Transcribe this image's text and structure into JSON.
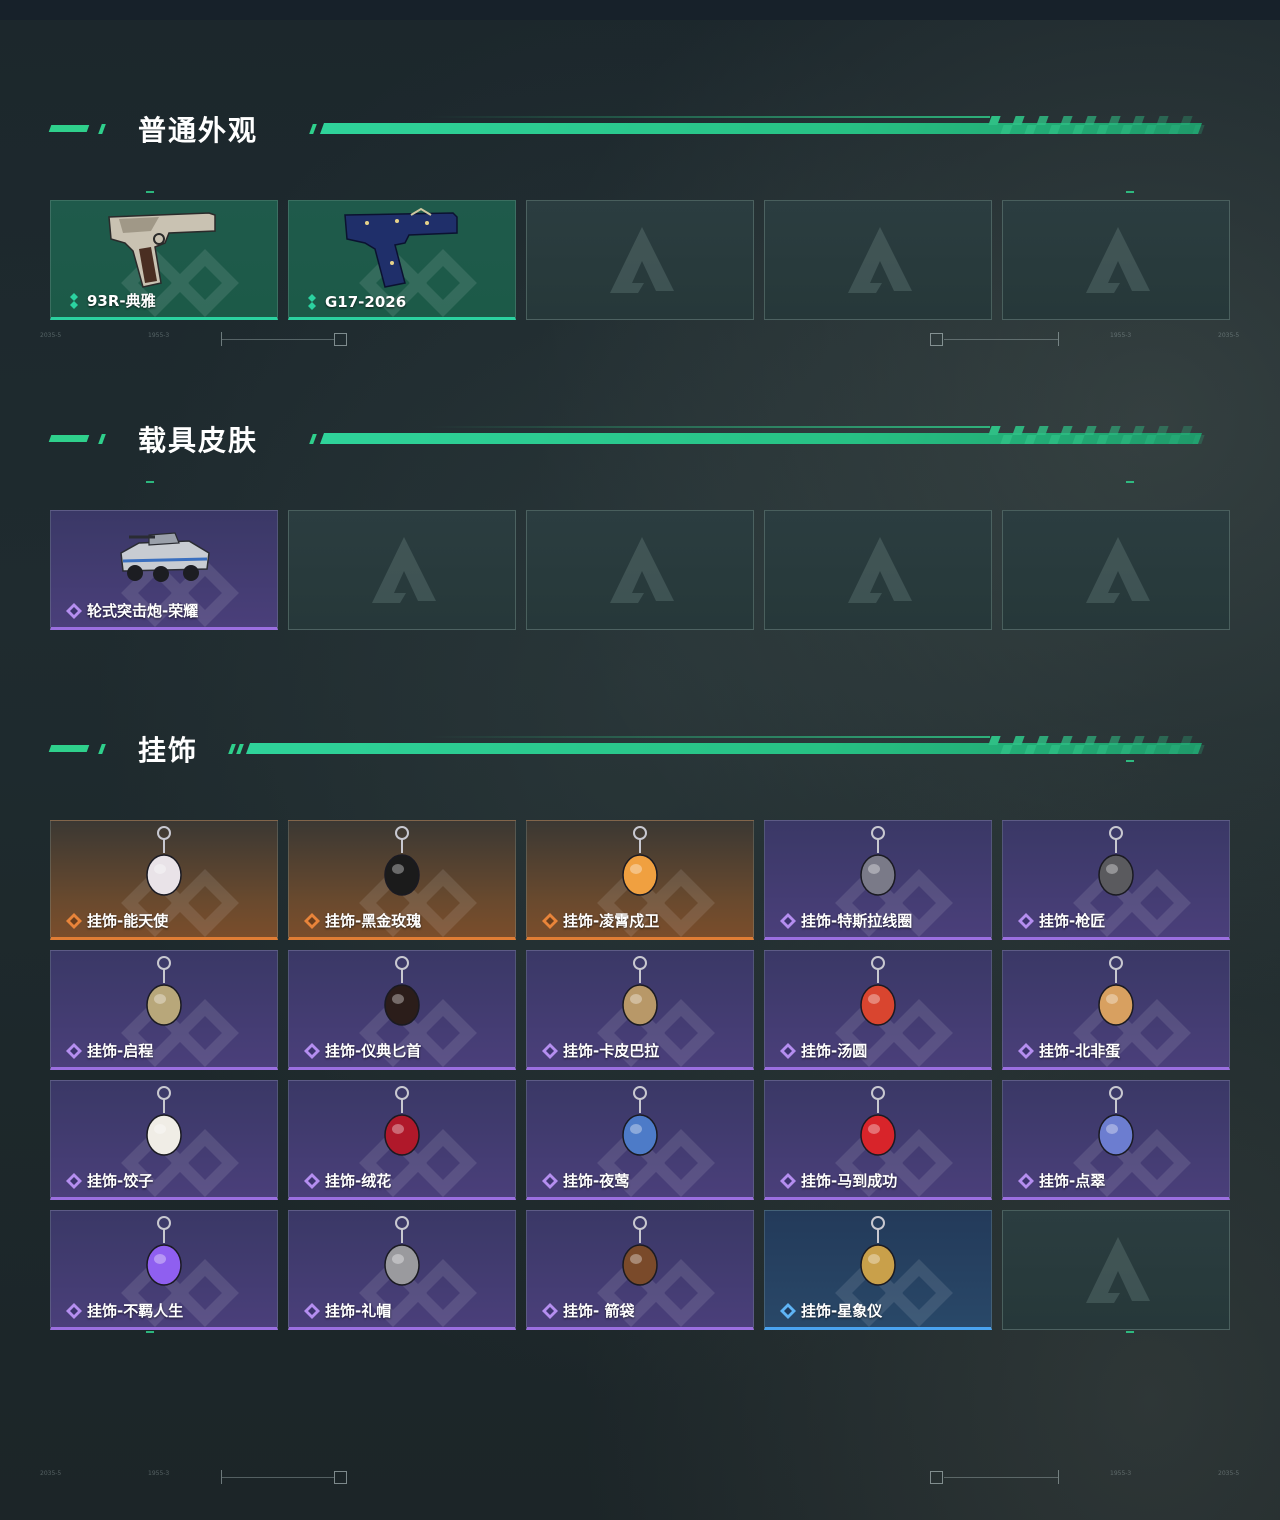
{
  "colors": {
    "accent": "#2fd08c",
    "rarity_green": "#2bd2a0",
    "rarity_purple": "#9b6fe0",
    "rarity_orange": "#e07d35",
    "rarity_blue": "#4aa3f0"
  },
  "scale_labels": [
    "2035-5",
    "1955-3"
  ],
  "sections": {
    "weapon_skins": {
      "title": "普通外观",
      "items": [
        {
          "name": "93R-典雅",
          "rarity": "green",
          "icon": "pistol-beige-icon"
        },
        {
          "name": "G17-2026",
          "rarity": "green",
          "icon": "pistol-navy-icon"
        },
        {
          "name": "",
          "rarity": "empty"
        },
        {
          "name": "",
          "rarity": "empty"
        },
        {
          "name": "",
          "rarity": "empty"
        }
      ]
    },
    "vehicle_skins": {
      "title": "载具皮肤",
      "items": [
        {
          "name": "轮式突击炮-荣耀",
          "rarity": "purple",
          "icon": "armored-vehicle-icon"
        },
        {
          "name": "",
          "rarity": "empty"
        },
        {
          "name": "",
          "rarity": "empty"
        },
        {
          "name": "",
          "rarity": "empty"
        },
        {
          "name": "",
          "rarity": "empty"
        }
      ]
    },
    "charms": {
      "title": "挂饰",
      "rows": [
        [
          {
            "name": "挂饰-能天使",
            "rarity": "orange",
            "icon": "tag-charm-icon"
          },
          {
            "name": "挂饰-黑金玫瑰",
            "rarity": "orange",
            "icon": "black-rose-charm-icon"
          },
          {
            "name": "挂饰-凌霄戍卫",
            "rarity": "orange",
            "icon": "guardian-charm-icon"
          },
          {
            "name": "挂饰-特斯拉线圈",
            "rarity": "purple",
            "icon": "tesla-coil-charm-icon"
          },
          {
            "name": "挂饰-枪匠",
            "rarity": "purple",
            "icon": "workbench-charm-icon"
          }
        ],
        [
          {
            "name": "挂饰-启程",
            "rarity": "purple",
            "icon": "medal-charm-icon"
          },
          {
            "name": "挂饰-仪典匕首",
            "rarity": "purple",
            "icon": "dagger-charm-icon"
          },
          {
            "name": "挂饰-卡皮巴拉",
            "rarity": "purple",
            "icon": "capybara-charm-icon"
          },
          {
            "name": "挂饰-汤圆",
            "rarity": "purple",
            "icon": "tangyuan-charm-icon"
          },
          {
            "name": "挂饰-北非蛋",
            "rarity": "purple",
            "icon": "shakshuka-charm-icon"
          }
        ],
        [
          {
            "name": "挂饰-饺子",
            "rarity": "purple",
            "icon": "dumpling-charm-icon"
          },
          {
            "name": "挂饰-绒花",
            "rarity": "purple",
            "icon": "velvet-flower-charm-icon"
          },
          {
            "name": "挂饰-夜莺",
            "rarity": "purple",
            "icon": "feather-charm-icon"
          },
          {
            "name": "挂饰-马到成功",
            "rarity": "purple",
            "icon": "red-horse-charm-icon"
          },
          {
            "name": "挂饰-点翠",
            "rarity": "purple",
            "icon": "kingfisher-charm-icon"
          }
        ],
        [
          {
            "name": "挂饰-不羁人生",
            "rarity": "purple",
            "icon": "sneaker-charm-icon"
          },
          {
            "name": "挂饰-礼帽",
            "rarity": "purple",
            "icon": "fedora-charm-icon"
          },
          {
            "name": "挂饰- 箭袋",
            "rarity": "purple",
            "icon": "quiver-charm-icon"
          },
          {
            "name": "挂饰-星象仪",
            "rarity": "blue",
            "icon": "astrolabe-charm-icon"
          },
          {
            "name": "",
            "rarity": "empty"
          }
        ]
      ]
    }
  }
}
